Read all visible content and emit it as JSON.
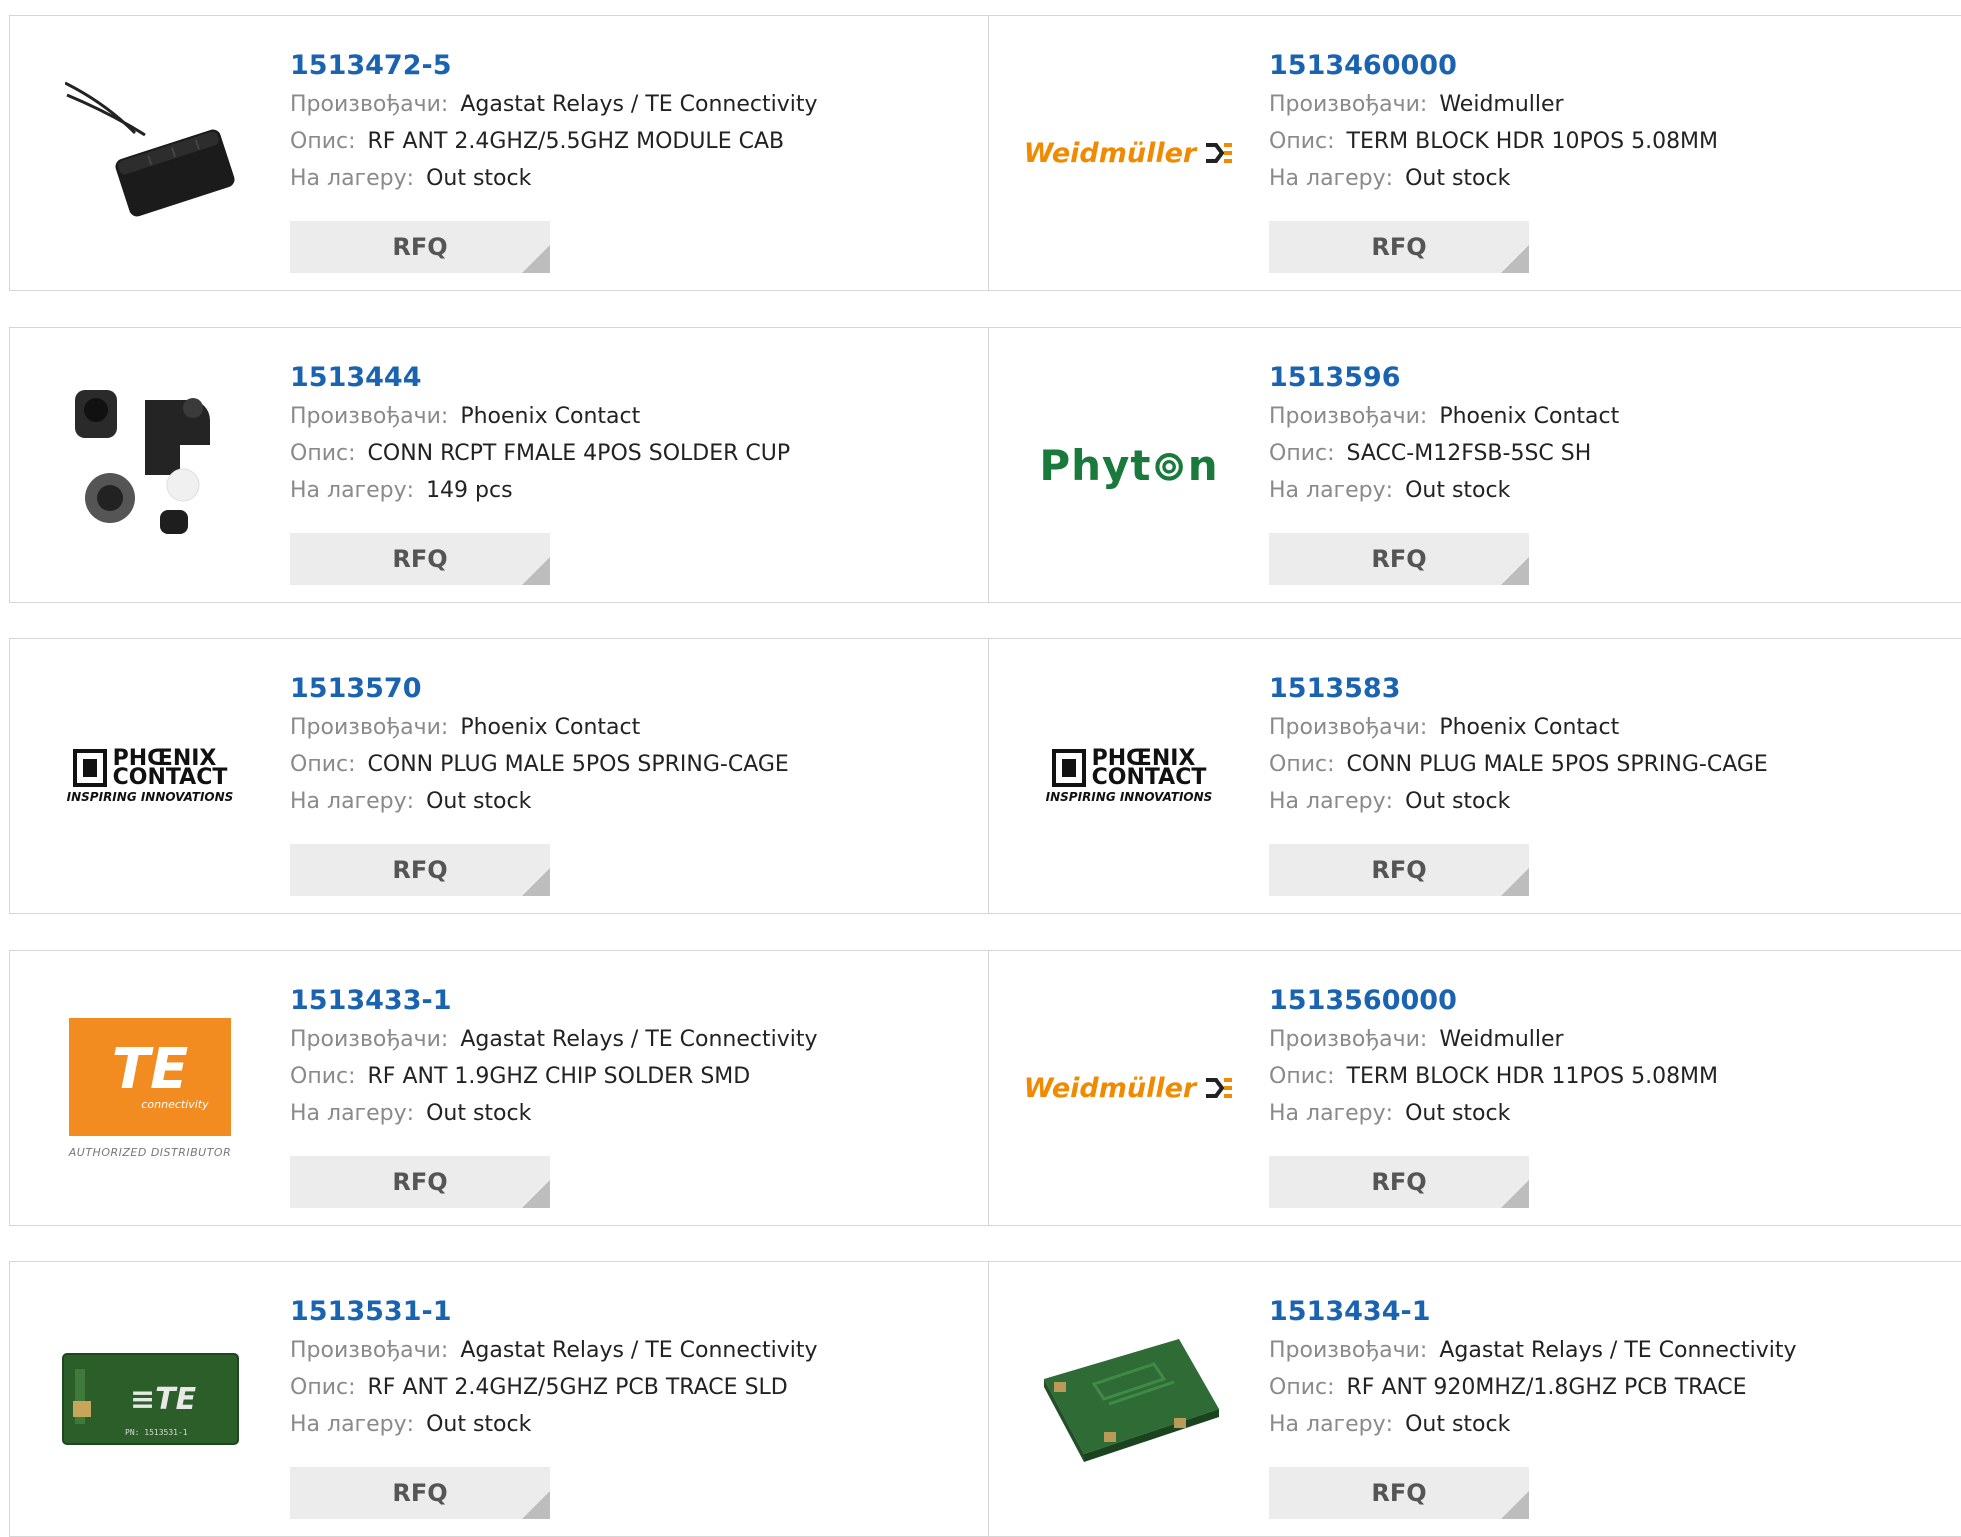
{
  "labels": {
    "manufacturer": "Произвођачи:",
    "description": "Опис:",
    "stock": "На лагеру:",
    "rfq": "RFQ"
  },
  "colors": {
    "accent": "#1a63b0",
    "weidmuller": "#f08a00",
    "phyton": "#1a7a3b",
    "te": "#f28c20"
  },
  "products": [
    {
      "part": "1513472-5",
      "manufacturer": "Agastat Relays / TE Connectivity",
      "description": "RF ANT 2.4GHZ/5.5GHZ MODULE CAB",
      "stock": "Out stock",
      "image": "antenna-module-photo"
    },
    {
      "part": "1513460000",
      "manufacturer": "Weidmuller",
      "description": "TERM BLOCK HDR 10POS 5.08MM",
      "stock": "Out stock",
      "image": "weidmuller-logo"
    },
    {
      "part": "1513444",
      "manufacturer": "Phoenix Contact",
      "description": "CONN RCPT FMALE 4POS SOLDER CUP",
      "stock": "149 pcs",
      "image": "connector-parts-photo"
    },
    {
      "part": "1513596",
      "manufacturer": "Phoenix Contact",
      "description": "SACC-M12FSB-5SC SH",
      "stock": "Out stock",
      "image": "phyton-logo"
    },
    {
      "part": "1513570",
      "manufacturer": "Phoenix Contact",
      "description": "CONN PLUG MALE 5POS SPRING-CAGE",
      "stock": "Out stock",
      "image": "phoenix-contact-logo"
    },
    {
      "part": "1513583",
      "manufacturer": "Phoenix Contact",
      "description": "CONN PLUG MALE 5POS SPRING-CAGE",
      "stock": "Out stock",
      "image": "phoenix-contact-logo"
    },
    {
      "part": "1513433-1",
      "manufacturer": "Agastat Relays / TE Connectivity",
      "description": "RF ANT 1.9GHZ CHIP SOLDER SMD",
      "stock": "Out stock",
      "image": "te-connectivity-logo"
    },
    {
      "part": "1513560000",
      "manufacturer": "Weidmuller",
      "description": "TERM BLOCK HDR 11POS 5.08MM",
      "stock": "Out stock",
      "image": "weidmuller-logo"
    },
    {
      "part": "1513531-1",
      "manufacturer": "Agastat Relays / TE Connectivity",
      "description": "RF ANT 2.4GHZ/5GHZ PCB TRACE SLD",
      "stock": "Out stock",
      "image": "pcb-antenna-te-photo"
    },
    {
      "part": "1513434-1",
      "manufacturer": "Agastat Relays / TE Connectivity",
      "description": "RF ANT 920MHZ/1.8GHZ PCB TRACE",
      "stock": "Out stock",
      "image": "pcb-antenna-green-photo"
    }
  ],
  "brand": {
    "weidmuller": "Weidmüller",
    "phyton": "Phyt⊚n",
    "phoenix_top": "PHŒNIX",
    "phoenix_bottom": "CONTACT",
    "phoenix_tag": "INSPIRING INNOVATIONS",
    "te_mark": "TE",
    "te_sub": "connectivity",
    "te_tag": "AUTHORIZED DISTRIBUTOR"
  }
}
